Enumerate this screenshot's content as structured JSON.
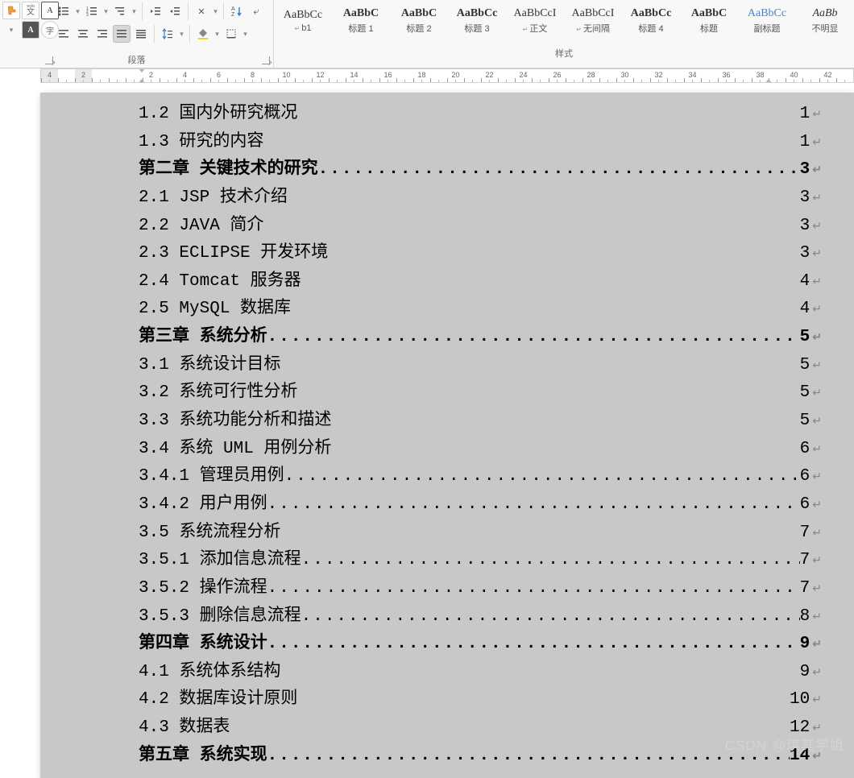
{
  "ribbon": {
    "paragraph": {
      "label": "段落",
      "icons": [
        "brush",
        "phonetic",
        "char-border",
        "bullets",
        "numbering",
        "multilevel",
        "outdent",
        "indent",
        "sort-asian",
        "sort",
        "show-marks",
        "highlight",
        "char-shading",
        "align-left",
        "align-center",
        "align-right",
        "justify",
        "distribute",
        "line-spacing",
        "shading",
        "borders"
      ]
    },
    "styles": {
      "label": "样式",
      "items": [
        {
          "preview": "AaBbCc",
          "name": "b1",
          "prefix": "↵",
          "blue": false,
          "bold": false,
          "italic": false
        },
        {
          "preview": "AaBbC",
          "name": "标题 1",
          "prefix": "",
          "blue": false,
          "bold": true,
          "italic": false
        },
        {
          "preview": "AaBbC",
          "name": "标题 2",
          "prefix": "",
          "blue": false,
          "bold": true,
          "italic": false
        },
        {
          "preview": "AaBbCc",
          "name": "标题 3",
          "prefix": "",
          "blue": false,
          "bold": true,
          "italic": false
        },
        {
          "preview": "AaBbCcI",
          "name": "正文",
          "prefix": "↵",
          "blue": false,
          "bold": false,
          "italic": false
        },
        {
          "preview": "AaBbCcI",
          "name": "无间隔",
          "prefix": "↵",
          "blue": false,
          "bold": false,
          "italic": false
        },
        {
          "preview": "AaBbCc",
          "name": "标题 4",
          "prefix": "",
          "blue": false,
          "bold": true,
          "italic": false
        },
        {
          "preview": "AaBbC",
          "name": "标题",
          "prefix": "",
          "blue": false,
          "bold": true,
          "italic": false
        },
        {
          "preview": "AaBbCc",
          "name": "副标题",
          "prefix": "",
          "blue": true,
          "bold": false,
          "italic": false
        },
        {
          "preview": "AaBb",
          "name": "不明显",
          "prefix": "",
          "blue": false,
          "bold": false,
          "italic": true
        }
      ]
    }
  },
  "ruler": {
    "numbers": [
      4,
      2,
      "",
      2,
      4,
      6,
      8,
      10,
      12,
      14,
      16,
      18,
      20,
      22,
      24,
      26,
      28,
      30,
      32,
      34,
      36,
      38,
      40,
      42
    ]
  },
  "toc": [
    {
      "title": "1.2 国内外研究概况",
      "page": "1",
      "bold": false,
      "dots": false
    },
    {
      "title": "1.3 研究的内容",
      "page": "1",
      "bold": false,
      "dots": false
    },
    {
      "title": "第二章 关键技术的研究",
      "page": "3",
      "bold": true,
      "dots": true
    },
    {
      "title": "2.1 JSP 技术介绍",
      "page": "3",
      "bold": false,
      "dots": false
    },
    {
      "title": "2.2 JAVA 简介",
      "page": "3",
      "bold": false,
      "dots": false
    },
    {
      "title": "2.3 ECLIPSE 开发环境",
      "page": "3",
      "bold": false,
      "dots": false
    },
    {
      "title": "2.4 Tomcat 服务器",
      "page": "4",
      "bold": false,
      "dots": false
    },
    {
      "title": "2.5 MySQL 数据库",
      "page": "4",
      "bold": false,
      "dots": false
    },
    {
      "title": "第三章 系统分析",
      "page": "5",
      "bold": true,
      "dots": true
    },
    {
      "title": "3.1 系统设计目标",
      "page": "5",
      "bold": false,
      "dots": false
    },
    {
      "title": "3.2 系统可行性分析",
      "page": "5",
      "bold": false,
      "dots": false
    },
    {
      "title": "3.3 系统功能分析和描述",
      "page": "5",
      "bold": false,
      "dots": false
    },
    {
      "title": "3.4 系统 UML 用例分析",
      "page": "6",
      "bold": false,
      "dots": false
    },
    {
      "title": "3.4.1 管理员用例",
      "page": "6",
      "bold": false,
      "dots": true
    },
    {
      "title": "3.4.2 用户用例",
      "page": "6",
      "bold": false,
      "dots": true
    },
    {
      "title": "3.5 系统流程分析",
      "page": "7",
      "bold": false,
      "dots": false
    },
    {
      "title": "3.5.1 添加信息流程",
      "page": "7",
      "bold": false,
      "dots": true
    },
    {
      "title": "3.5.2 操作流程",
      "page": "7",
      "bold": false,
      "dots": true
    },
    {
      "title": "3.5.3 删除信息流程",
      "page": "8",
      "bold": false,
      "dots": true
    },
    {
      "title": "第四章 系统设计",
      "page": "9",
      "bold": true,
      "dots": true
    },
    {
      "title": "4.1 系统体系结构",
      "page": "9",
      "bold": false,
      "dots": false
    },
    {
      "title": "4.2 数据库设计原则",
      "page": "10",
      "bold": false,
      "dots": false
    },
    {
      "title": "4.3 数据表",
      "page": "12",
      "bold": false,
      "dots": false
    },
    {
      "title": "第五章 系统实现",
      "page": "14",
      "bold": true,
      "dots": true
    }
  ],
  "watermark": "CSDN @琪其学姐"
}
